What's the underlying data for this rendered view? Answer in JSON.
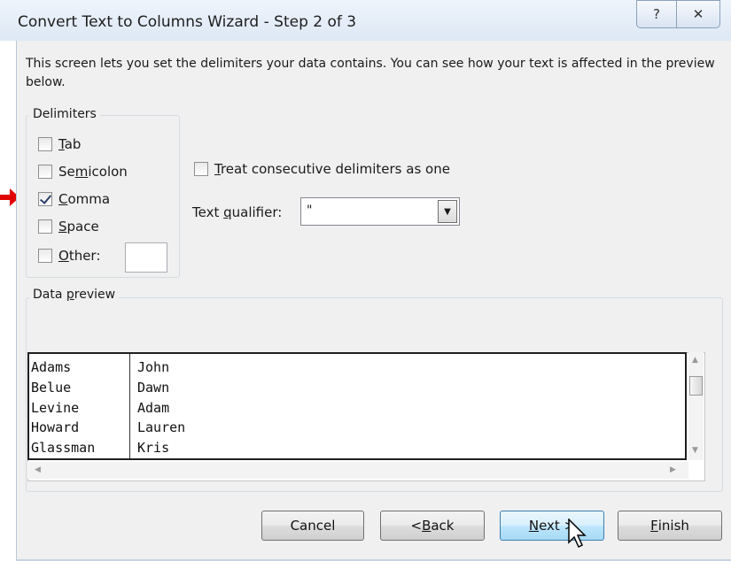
{
  "window": {
    "title": "Convert Text to Columns Wizard - Step 2 of 3",
    "help_label": "?",
    "close_label": "✕"
  },
  "intro": "This screen lets you set the delimiters your data contains.  You can see how your text is affected in the preview below.",
  "delimiters": {
    "label": "Delimiters",
    "items": [
      {
        "label": "Tab",
        "checked": false
      },
      {
        "label": "Semicolon",
        "checked": false
      },
      {
        "label": "Comma",
        "checked": true
      },
      {
        "label": "Space",
        "checked": false
      },
      {
        "label": "Other:",
        "checked": false
      }
    ],
    "other_value": ""
  },
  "consecutive": {
    "label": "Treat consecutive delimiters as one",
    "checked": false
  },
  "qualifier": {
    "label": "Text qualifier:",
    "value": "\""
  },
  "preview": {
    "label": "Data preview",
    "rows": [
      [
        "Adams",
        "John"
      ],
      [
        "Belue",
        "Dawn"
      ],
      [
        "Levine",
        "Adam"
      ],
      [
        "Howard",
        "Lauren"
      ],
      [
        "Glassman",
        "Kris"
      ]
    ]
  },
  "buttons": {
    "cancel": "Cancel",
    "back": "< Back",
    "next": "Next >",
    "finish": "Finish"
  },
  "colors": {
    "annotation_arrow": "#e00000",
    "default_button": "#bee6fd"
  }
}
